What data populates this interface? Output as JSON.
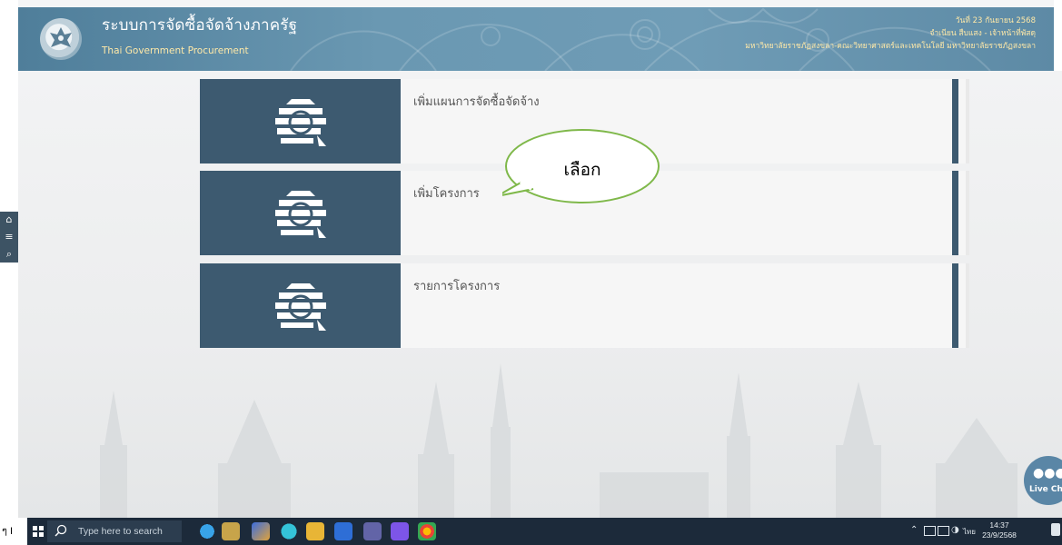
{
  "header": {
    "title_th": "ระบบการจัดซื้อจัดจ้างภาครัฐ",
    "title_en": "Thai Government Procurement",
    "date_line": "วันที่ 23 กันยายน 2568",
    "user_line": "จำเนียน สืบแสง - เจ้าหน้าที่พัสดุ",
    "org_line": "มหาวิทยาลัยราชภัฏสงขลา-คณะวิทยาศาสตร์และเทคโนโลยี มหาวิทยาลัยราชภัฏสงขลา"
  },
  "side_tools": [
    {
      "name": "home-icon",
      "glyph": "⌂"
    },
    {
      "name": "menu-icon",
      "glyph": "≡"
    },
    {
      "name": "search-icon",
      "glyph": "⌕"
    }
  ],
  "menu": [
    {
      "label": "เพิ่มแผนการจัดซื้อจัดจ้าง"
    },
    {
      "label": "เพิ่มโครงการ"
    },
    {
      "label": "รายการโครงการ"
    }
  ],
  "annotation": {
    "text": "เลือก"
  },
  "live_chat": {
    "label": "Live Ch"
  },
  "taskbar": {
    "page_number": "ๆ I",
    "search_placeholder": "Type here to search",
    "clock_time": "14:37",
    "clock_date": "23/9/2568",
    "ime": "ไทย"
  },
  "colors": {
    "header_blue": "#6a98b2",
    "card_blue": "#3d5a70",
    "bubble_green": "#7fb84a",
    "taskbar": "#1c2a3a"
  }
}
